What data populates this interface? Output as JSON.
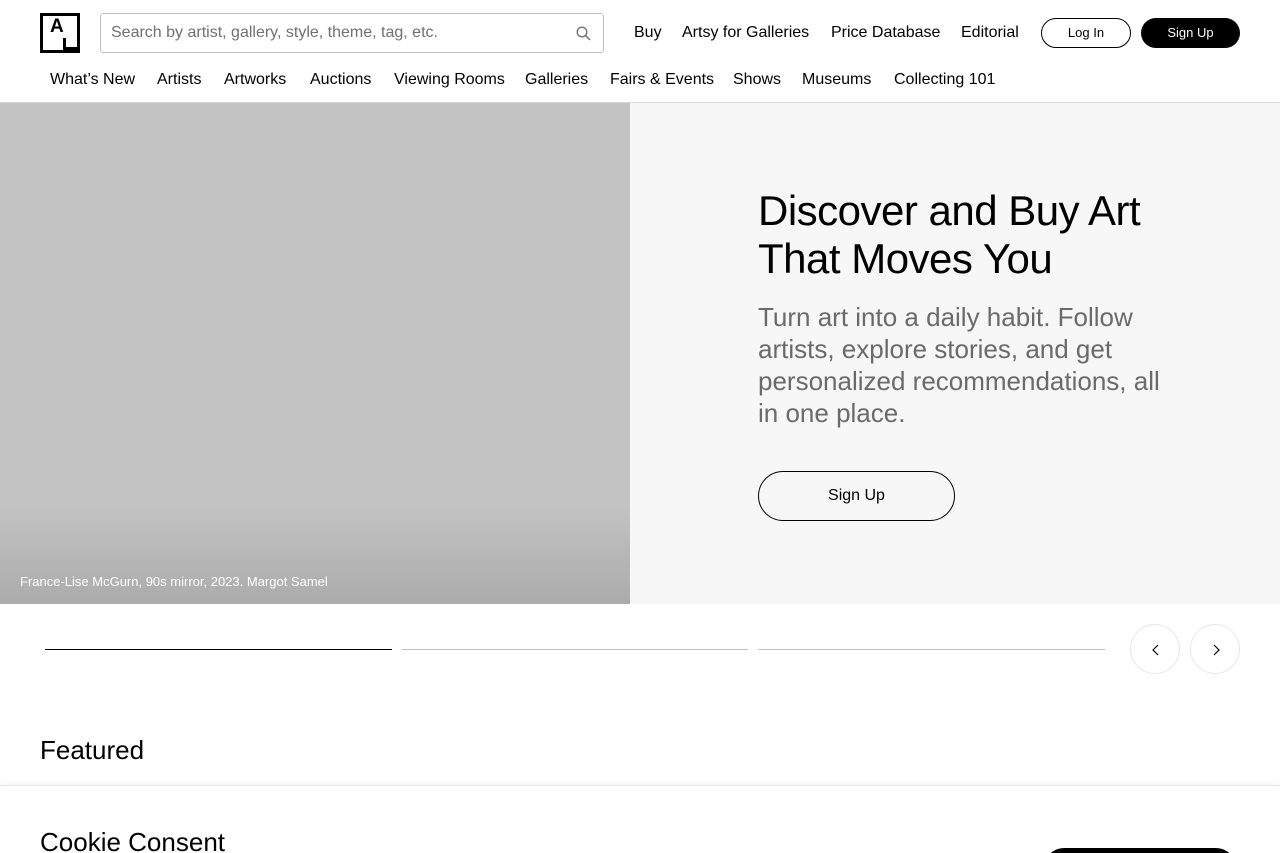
{
  "header": {
    "logo_letter": "A",
    "search": {
      "placeholder": "Search by artist, gallery, style, theme, tag, etc."
    },
    "top_links": [
      "Buy",
      "Artsy for Galleries",
      "Price Database",
      "Editorial"
    ],
    "login_label": "Log In",
    "signup_label": "Sign Up"
  },
  "subnav": [
    "What’s New",
    "Artists",
    "Artworks",
    "Auctions",
    "Viewing Rooms",
    "Galleries",
    "Fairs & Events",
    "Shows",
    "Museums",
    "Collecting 101"
  ],
  "hero": {
    "caption": "France-Lise McGurn, 90s mirror, 2023. Margot Samel",
    "title": "Discover and Buy Art That Moves You",
    "subtitle": "Turn art into a daily habit. Follow artists, explore stories, and get personalized recommendations, all in one place.",
    "cta_label": "Sign Up"
  },
  "carousel": {
    "slide_count": 3,
    "active_slide": 1
  },
  "featured_heading": "Featured",
  "cookie": {
    "title": "Cookie Consent"
  },
  "colors": {
    "hero_image": "#c3c3c3",
    "hero_panel": "#f7f7f7",
    "subtitle": "#6a6a6a",
    "accent": "#000000"
  },
  "icons": [
    "search-icon",
    "chevron-left-icon",
    "chevron-right-icon"
  ]
}
